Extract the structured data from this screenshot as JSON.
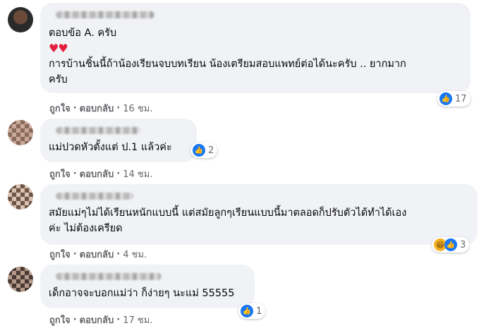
{
  "comments": [
    {
      "text_line1": "ตอบข้อ A. ครับ",
      "hearts": "♥♥",
      "text_line2": "การบ้านชิ้นนี้ถ้าน้องเรียนจบบทเรียน น้องเตรียมสอบแพทย์ต่อได้นะครับ .. ยากมาก",
      "text_line3": "ครับ",
      "reaction_count": "17",
      "like": "ถูกใจ",
      "reply": "ตอบกลับ",
      "time": "16 ชม."
    },
    {
      "text_line1": "แม่ปวดหัวตั้งแต่ ป.1 แล้วค่ะ",
      "reaction_count": "2",
      "like": "ถูกใจ",
      "reply": "ตอบกลับ",
      "time": "14 ชม."
    },
    {
      "text_line1": "สมัยแม่ๆไม่ได้เรียนหนักแบบนี้ แต่สมัยลูกๆเรียนแบบนี้มาตลอดก็ปรับตัวได้ทำได้เอง",
      "text_line2": "ค่ะ ไม่ต้องเครียด",
      "reaction_count": "3",
      "like": "ถูกใจ",
      "reply": "ตอบกลับ",
      "time": "4 ชม."
    },
    {
      "text_line1": "เด็กอาจจะบอกแม่ว่า ก็ง่ายๆ นะแม่ 55555",
      "reaction_count": "1",
      "like": "ถูกใจ",
      "reply": "ตอบกลับ",
      "time": "17 ชม."
    }
  ],
  "separator": "·",
  "icons": {
    "like": "like-icon",
    "haha": "haha-icon"
  },
  "colors": {
    "bubble": "#f0f2f5",
    "like_blue": "#1877f2",
    "meta_gray": "#65676b"
  }
}
